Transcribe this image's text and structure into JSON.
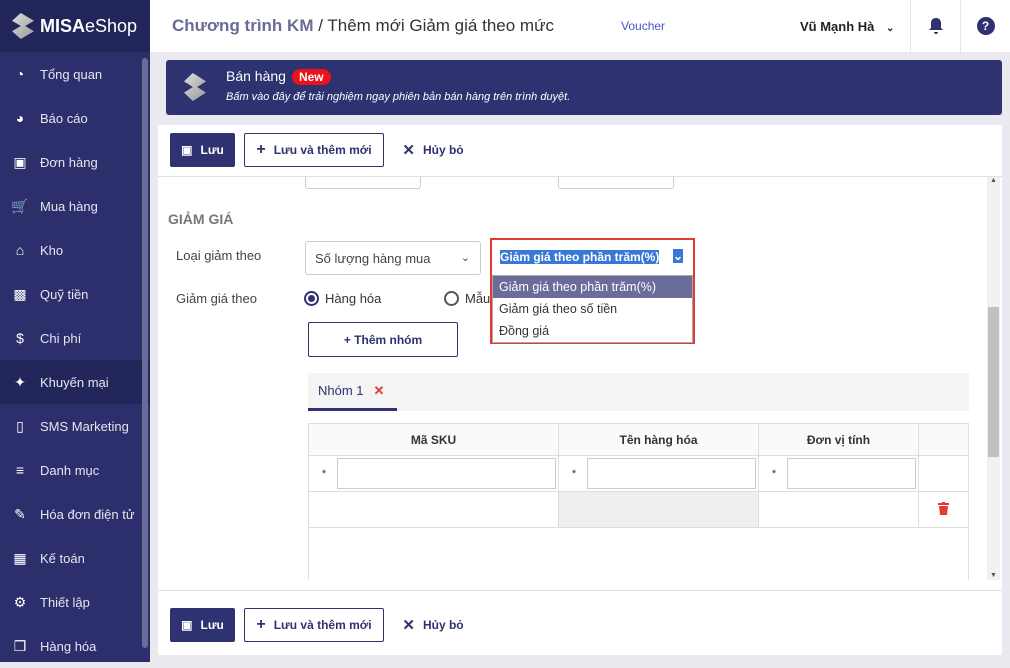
{
  "sidebar": {
    "brand": "MISA",
    "brand_suffix": "eShop",
    "items": [
      {
        "label": "Tổng quan",
        "icon": "dashboard-icon"
      },
      {
        "label": "Báo cáo",
        "icon": "pie-chart-icon"
      },
      {
        "label": "Đơn hàng",
        "icon": "order-icon"
      },
      {
        "label": "Mua hàng",
        "icon": "cart-icon"
      },
      {
        "label": "Kho",
        "icon": "warehouse-icon"
      },
      {
        "label": "Quỹ tiền",
        "icon": "safe-icon"
      },
      {
        "label": "Chi phí",
        "icon": "money-bag-icon"
      },
      {
        "label": "Khuyến mại",
        "icon": "gift-icon"
      },
      {
        "label": "SMS Marketing",
        "icon": "phone-icon"
      },
      {
        "label": "Danh mục",
        "icon": "list-icon"
      },
      {
        "label": "Hóa đơn điện tử",
        "icon": "invoice-icon"
      },
      {
        "label": "Kế toán",
        "icon": "calculator-icon"
      },
      {
        "label": "Thiết lập",
        "icon": "gear-icon"
      },
      {
        "label": "Hàng hóa",
        "icon": "boxes-icon"
      }
    ]
  },
  "header": {
    "breadcrumb_parent": "Chương trình KM",
    "separator": " / ",
    "title": "Thêm mới Giảm giá theo mức",
    "voucher": "Voucher",
    "user": "Vũ Mạnh Hà"
  },
  "banner": {
    "title": "Bán hàng",
    "badge": "New",
    "subtitle": "Bấm vào đây để trải nghiệm ngay phiên bản bán hàng trên trình duyệt."
  },
  "toolbar": {
    "save": "Lưu",
    "save_new": "Lưu và thêm mới",
    "cancel": "Hủy bỏ"
  },
  "form": {
    "section": "GIẢM GIÁ",
    "type_label": "Loại giảm theo",
    "type_value": "Số lượng hàng mua",
    "discount_value": "Giảm giá theo phần trăm(%)",
    "options": [
      "Giảm giá theo phần trăm(%)",
      "Giảm giá theo số tiền",
      "Đồng giá"
    ],
    "by_label": "Giảm giá theo",
    "radio_goods": "Hàng hóa",
    "radio_model": "Mẫu",
    "add_group": "+ Thêm nhóm",
    "group_tab": "Nhóm 1",
    "columns": [
      "Mã SKU",
      "Tên hàng hóa",
      "Đơn vị tính"
    ],
    "required": "*"
  },
  "colors": {
    "primary": "#2e3270",
    "danger": "#e53935"
  }
}
